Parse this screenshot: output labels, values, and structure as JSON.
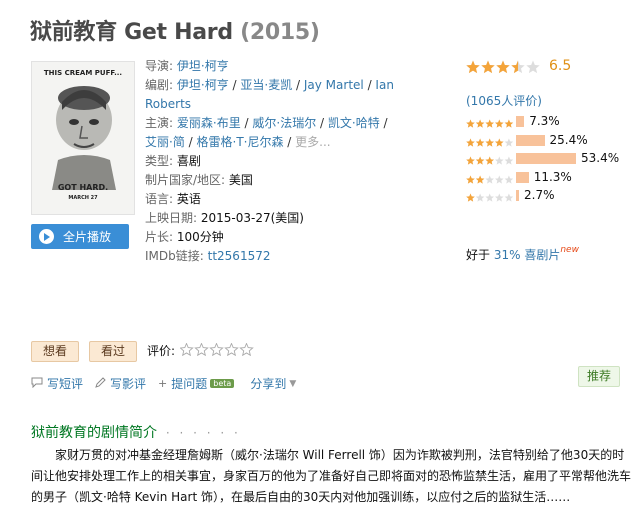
{
  "title": {
    "main": "狱前教育 Get Hard",
    "year": "(2015)"
  },
  "poster": {
    "tagline": "THIS CREAM PUFF...",
    "headline": "GOT HARD.",
    "date": "MARCH 27"
  },
  "play_button": {
    "label": "全片播放"
  },
  "info": {
    "director_label": "导演:",
    "director": "伊坦·柯亨",
    "writer_label": "编剧:",
    "writers": [
      "伊坦·柯亨",
      "亚当·麦凯",
      "Jay Martel",
      "Ian Roberts"
    ],
    "cast_label": "主演:",
    "cast": [
      "爱丽森·布里",
      "威尔·法瑞尔",
      "凯文·哈特",
      "艾丽·简",
      "格雷格·T·尼尔森"
    ],
    "cast_more": "更多...",
    "genre_label": "类型:",
    "genre": "喜剧",
    "country_label": "制片国家/地区:",
    "country": "美国",
    "language_label": "语言:",
    "language": "英语",
    "release_label": "上映日期:",
    "release": "2015-03-27(美国)",
    "runtime_label": "片长:",
    "runtime": "100分钟",
    "imdb_label": "IMDb链接:",
    "imdb": "tt2561572"
  },
  "rating": {
    "score": "6.5",
    "stars_value": 3.5,
    "count": "(1065人评价)",
    "distribution": [
      {
        "stars": 5,
        "percent": 7.3,
        "label": "7.3%"
      },
      {
        "stars": 4,
        "percent": 25.4,
        "label": "25.4%"
      },
      {
        "stars": 3,
        "percent": 53.4,
        "label": "53.4%"
      },
      {
        "stars": 2,
        "percent": 11.3,
        "label": "11.3%"
      },
      {
        "stars": 1,
        "percent": 2.7,
        "label": "2.7%"
      }
    ]
  },
  "comparison": {
    "prefix": "好于 ",
    "link": "31% 喜剧片",
    "badge": "new"
  },
  "interest": {
    "want": "想看",
    "seen": "看过",
    "rate_label": "评价:"
  },
  "actions": {
    "short_review": "写短评",
    "review": "写影评",
    "question": "提问题",
    "beta": "beta",
    "share": "分享到",
    "recommend": "推荐"
  },
  "synopsis": {
    "heading": "狱前教育的剧情简介",
    "dots": "· · · · · ·",
    "text": "家财万贯的对冲基金经理詹姆斯（威尔·法瑞尔 Will Ferrell 饰）因为诈欺被判刑，法官特别给了他30天的时间让他安排处理工作上的相关事宜，身家百万的他为了准备好自己即将面对的恐怖监禁生活，雇用了平常帮他洗车的男子（凯文·哈特 Kevin Hart 饰），在最后自由的30天内对他加强训练，以应付之后的监狱生活……"
  },
  "colors": {
    "accent": "#3377aa",
    "star": "#f4a43a",
    "bar": "#f8c29a",
    "green": "#007722",
    "play": "#3a8ed6"
  }
}
